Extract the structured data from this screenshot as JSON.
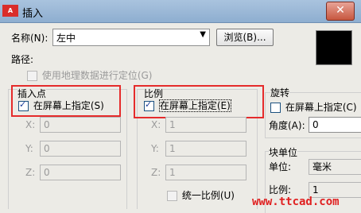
{
  "window": {
    "icon_label": "A",
    "title": "插入",
    "close_label": "✕"
  },
  "name_row": {
    "label": "名称(N):",
    "value": "左中",
    "browse_label": "浏览(B)..."
  },
  "path": {
    "label": "路径:",
    "geo_checkbox_label": "使用地理数据进行定位(G)"
  },
  "insertion_point": {
    "title": "插入点",
    "specify_label": "在屏幕上指定(S)",
    "x_label": "X:",
    "x_value": "0",
    "y_label": "Y:",
    "y_value": "0",
    "z_label": "Z:",
    "z_value": "0"
  },
  "scale": {
    "title": "比例",
    "specify_label": "在屏幕上指定(E)",
    "x_label": "X:",
    "x_value": "1",
    "y_label": "Y:",
    "y_value": "1",
    "z_label": "Z:",
    "z_value": "1",
    "uniform_label": "统一比例(U)"
  },
  "rotation": {
    "title": "旋转",
    "specify_label": "在屏幕上指定(C)",
    "angle_label": "角度(A):",
    "angle_value": "0"
  },
  "block_unit": {
    "title": "块单位",
    "unit_label": "单位:",
    "unit_value": "毫米",
    "scale_label": "比例:",
    "scale_value": "1"
  },
  "watermark": "www.ttcad.com",
  "colors": {
    "highlight": "#e52b2b",
    "titlebar": "#a9c3de"
  }
}
